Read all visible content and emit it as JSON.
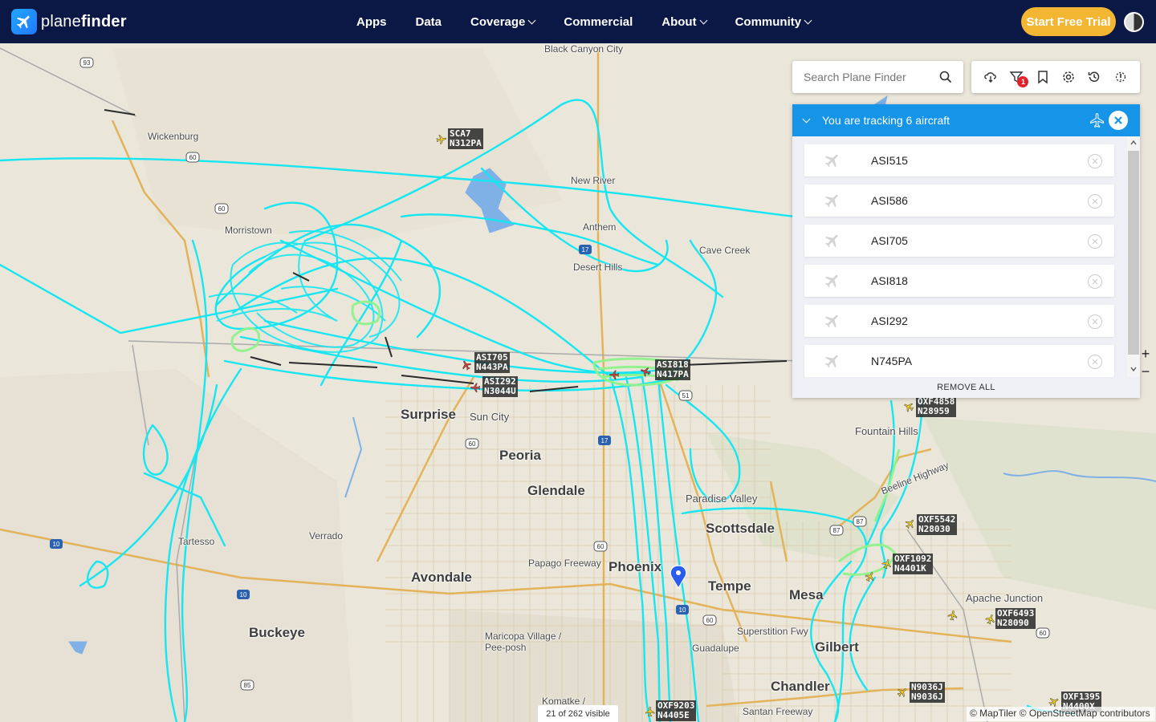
{
  "brand": {
    "name_light": "plane",
    "name_bold": "finder"
  },
  "nav": {
    "items": [
      {
        "label": "Apps",
        "has_menu": false
      },
      {
        "label": "Data",
        "has_menu": false
      },
      {
        "label": "Coverage",
        "has_menu": true
      },
      {
        "label": "Commercial",
        "has_menu": false
      },
      {
        "label": "About",
        "has_menu": true
      },
      {
        "label": "Community",
        "has_menu": true
      }
    ],
    "cta_label": "Start Free Trial"
  },
  "search": {
    "placeholder": "Search Plane Finder"
  },
  "toolbar": {
    "icons": [
      "weather-icon",
      "filter-icon",
      "bookmark-icon",
      "settings-icon",
      "history-icon",
      "alerts-icon"
    ],
    "filter_badge": "1"
  },
  "tracking": {
    "title": "You are tracking 6 aircraft",
    "aircraft": [
      "ASI515",
      "ASI586",
      "ASI705",
      "ASI818",
      "ASI292",
      "N745PA"
    ],
    "remove_all_label": "REMOVE ALL"
  },
  "map": {
    "visible_count": "21 of 262 visible",
    "attribution": "© MapTiler © OpenStreetMap contributors",
    "places": [
      {
        "name": "Black Canyon City",
        "size": "sm"
      },
      {
        "name": "Wickenburg",
        "size": "sm"
      },
      {
        "name": "New River",
        "size": "sm"
      },
      {
        "name": "Anthem",
        "size": "sm"
      },
      {
        "name": "Desert Hills",
        "size": "sm"
      },
      {
        "name": "Cave Creek",
        "size": "sm"
      },
      {
        "name": "Morristown",
        "size": "sm"
      },
      {
        "name": "Surprise",
        "size": "lg"
      },
      {
        "name": "Sun City",
        "size": "md"
      },
      {
        "name": "Peoria",
        "size": "lg"
      },
      {
        "name": "Glendale",
        "size": "lg"
      },
      {
        "name": "Fountain Hills",
        "size": "md"
      },
      {
        "name": "Paradise Valley",
        "size": "md"
      },
      {
        "name": "Scottsdale",
        "size": "lg"
      },
      {
        "name": "Tartesso",
        "size": "sm"
      },
      {
        "name": "Verrado",
        "size": "sm"
      },
      {
        "name": "Avondale",
        "size": "lg"
      },
      {
        "name": "Phoenix",
        "size": "lg"
      },
      {
        "name": "Tempe",
        "size": "lg"
      },
      {
        "name": "Mesa",
        "size": "lg"
      },
      {
        "name": "Buckeye",
        "size": "lg"
      },
      {
        "name": "Papago Freeway",
        "size": "sm"
      },
      {
        "name": "Maricopa Village / Pee-posh",
        "size": "sm"
      },
      {
        "name": "Guadalupe",
        "size": "sm"
      },
      {
        "name": "Superstition Fwy",
        "size": "sm"
      },
      {
        "name": "Gilbert",
        "size": "lg"
      },
      {
        "name": "Apache Junction",
        "size": "md"
      },
      {
        "name": "Chandler",
        "size": "lg"
      },
      {
        "name": "Komatke /",
        "size": "sm"
      },
      {
        "name": "Santan Freeway",
        "size": "sm"
      },
      {
        "name": "Beeline Highway",
        "size": "sm"
      }
    ],
    "aircraft_labels": [
      {
        "callsign": "SCA7",
        "reg": "N312PA"
      },
      {
        "callsign": "ASI705",
        "reg": "N443PA"
      },
      {
        "callsign": "ASI292",
        "reg": "N3044U"
      },
      {
        "callsign": "ASI818",
        "reg": "N417PA"
      },
      {
        "callsign": "OXF4858",
        "reg": "N28959"
      },
      {
        "callsign": "OXF5542",
        "reg": "N28030"
      },
      {
        "callsign": "OXF1092",
        "reg": "N4401K"
      },
      {
        "callsign": "OXF6493",
        "reg": "N28090"
      },
      {
        "callsign": "N9036J",
        "reg": "N9036J"
      },
      {
        "callsign": "OXF9203",
        "reg": "N4405E"
      },
      {
        "callsign": "OXF1395",
        "reg": "N4400X"
      }
    ],
    "highway_shields": [
      "93",
      "60",
      "60",
      "17",
      "17",
      "51",
      "60",
      "87",
      "87",
      "10",
      "10",
      "10",
      "60",
      "60",
      "85",
      "60"
    ]
  }
}
